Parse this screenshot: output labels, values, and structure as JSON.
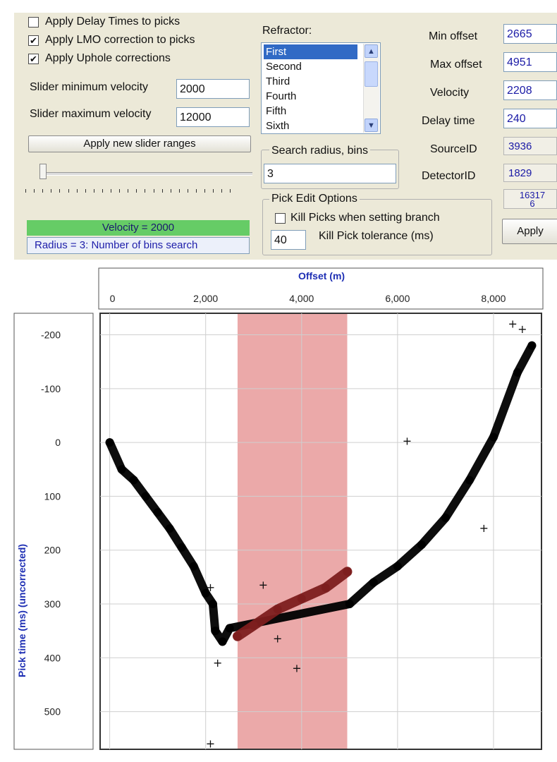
{
  "options": {
    "apply_delay_times": {
      "label": "Apply Delay Times to picks",
      "checked": false
    },
    "apply_lmo": {
      "label": "Apply LMO correction to picks",
      "checked": true
    },
    "apply_uphole": {
      "label": "Apply Uphole corrections",
      "checked": true
    }
  },
  "slider_ranges": {
    "min_label": "Slider minimum velocity",
    "min_value": "2000",
    "max_label": "Slider maximum velocity",
    "max_value": "12000",
    "apply_button": "Apply new slider ranges"
  },
  "velocity_slider": {
    "position_fraction": 0.0
  },
  "status": {
    "velocity": "Velocity = 2000",
    "radius": "Radius = 3:  Number of bins search"
  },
  "refractor": {
    "label": "Refractor:",
    "items": [
      "First",
      "Second",
      "Third",
      "Fourth",
      "Fifth",
      "Sixth"
    ],
    "selected": "First"
  },
  "search_radius": {
    "label": "Search radius, bins",
    "value": "3"
  },
  "pick_edit": {
    "title": "Pick Edit Options",
    "kill_picks": {
      "label": "Kill Picks when setting branch",
      "checked": false
    },
    "tolerance_value": "40",
    "tolerance_label": "Kill Pick tolerance (ms)"
  },
  "fields": {
    "min_offset": {
      "label": "Min offset",
      "value": "2665"
    },
    "max_offset": {
      "label": "Max offset",
      "value": "4951"
    },
    "velocity": {
      "label": "Velocity",
      "value": "2208"
    },
    "delay_time": {
      "label": "Delay time",
      "value": "240"
    },
    "source_id": {
      "label": "SourceID",
      "value": "3936"
    },
    "detector_id": {
      "label": "DetectorID",
      "value": "1829"
    },
    "extra_value": "16317\n6",
    "apply_button": "Apply"
  },
  "chart_data": {
    "type": "scatter",
    "xlabel": "Offset (m)",
    "ylabel": "Pick time (ms) (uncorrected)",
    "xlim": [
      -200,
      9000
    ],
    "ylim": [
      -240,
      570
    ],
    "xticks": [
      0,
      2000,
      4000,
      6000,
      8000
    ],
    "xtick_labels": [
      "0",
      "2,000",
      "4,000",
      "6,000",
      "8,000"
    ],
    "yticks": [
      -200,
      -100,
      0,
      100,
      200,
      300,
      400,
      500
    ],
    "ytick_labels": [
      "-200",
      "-100",
      "0",
      "100",
      "200",
      "300",
      "400",
      "500"
    ],
    "x_axis_position": "top",
    "grid": true,
    "highlight_band": {
      "x": [
        2665,
        4951
      ],
      "color": "#e79a9a"
    },
    "series": [
      {
        "color": "#000000",
        "points": [
          [
            0,
            0
          ],
          [
            250,
            50
          ],
          [
            500,
            70
          ],
          [
            750,
            100
          ],
          [
            1000,
            130
          ],
          [
            1250,
            160
          ],
          [
            1500,
            195
          ],
          [
            1750,
            230
          ],
          [
            2000,
            280
          ],
          [
            2150,
            300
          ],
          [
            2200,
            350
          ],
          [
            2350,
            370
          ],
          [
            2500,
            345
          ],
          [
            5000,
            300
          ],
          [
            5500,
            260
          ],
          [
            6000,
            230
          ],
          [
            6500,
            190
          ],
          [
            7000,
            140
          ],
          [
            7500,
            70
          ],
          [
            8000,
            -10
          ],
          [
            8500,
            -130
          ],
          [
            8800,
            -180
          ]
        ]
      },
      {
        "color": "#7d1e1e",
        "points": [
          [
            2665,
            360
          ],
          [
            3000,
            340
          ],
          [
            3500,
            310
          ],
          [
            4000,
            290
          ],
          [
            4500,
            270
          ],
          [
            4951,
            240
          ]
        ]
      }
    ],
    "outliers": [
      [
        2100,
        270
      ],
      [
        2250,
        410
      ],
      [
        2100,
        560
      ],
      [
        3200,
        265
      ],
      [
        3500,
        365
      ],
      [
        3900,
        420
      ],
      [
        6200,
        -2
      ],
      [
        7800,
        160
      ],
      [
        8400,
        -220
      ],
      [
        8600,
        -210
      ]
    ]
  }
}
